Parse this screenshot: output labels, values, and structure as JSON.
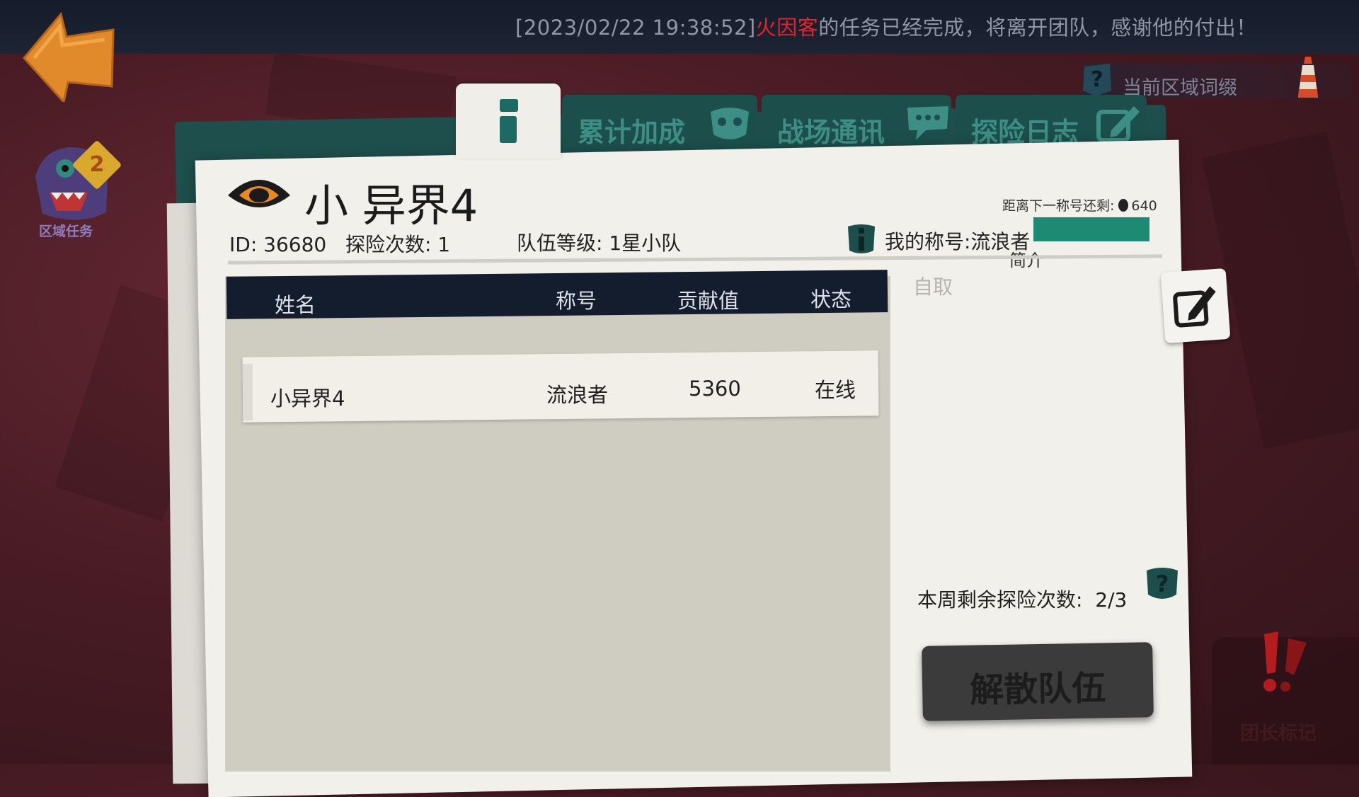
{
  "notification": {
    "timestamp": "[2023/02/22 19:38:52]",
    "player_name": "火因客",
    "message": "的任务已经完成，将离开团队，感谢他的付出！"
  },
  "left_panel": {
    "quest_label": "区域任务",
    "quest_count": "2"
  },
  "region_affix": {
    "label": "当前区域词缀"
  },
  "tabs": [
    {
      "label": "累计加成",
      "icon": "mask-icon"
    },
    {
      "label": "战场通讯",
      "icon": "chat-icon"
    },
    {
      "label": "探险日志",
      "icon": "edit-icon"
    }
  ],
  "team": {
    "name": "小 异界4",
    "id_text": "ID: 36680",
    "explore_text": "探险次数: 1",
    "level_text": "队伍等级: 1星小队",
    "next_title_label": "距离下一称号还剩:",
    "next_title_value": "640",
    "my_title_text": "我的称号:流浪者",
    "intro_label": "简介",
    "intro_text": "自取"
  },
  "table": {
    "headers": [
      "姓名",
      "称号",
      "贡献值",
      "状态"
    ],
    "rows": [
      {
        "name": "小异界4",
        "title": "流浪者",
        "contribution": "5360",
        "status": "在线"
      }
    ]
  },
  "weekly": {
    "label": "本周剩余探险次数:",
    "value": "2/3"
  },
  "dissolve_button": "解散队伍",
  "leader_mark": "团长标记",
  "colors": {
    "accent_teal": "#1c4f4b",
    "progress_green": "#1d8a74",
    "notify_red": "#e8222a",
    "back_orange": "#e08a2b"
  }
}
